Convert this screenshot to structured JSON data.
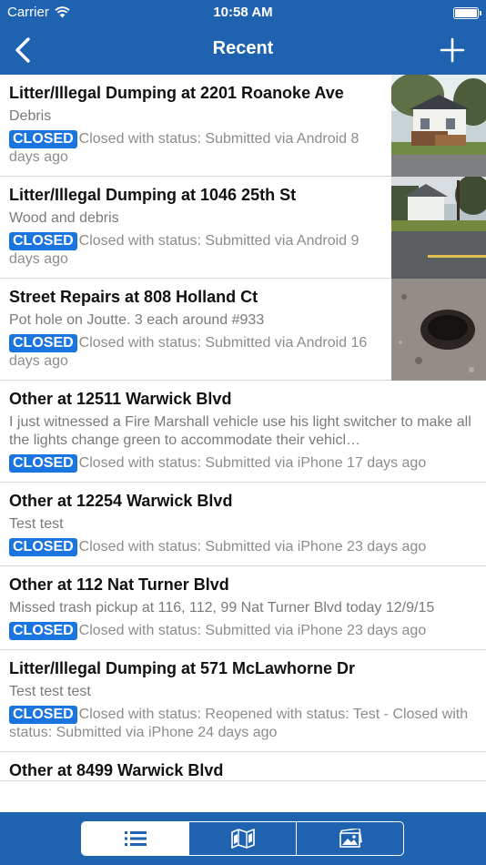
{
  "status_bar": {
    "carrier": "Carrier",
    "time": "10:58 AM"
  },
  "nav": {
    "title": "Recent"
  },
  "badge_label": "CLOSED",
  "reports": [
    {
      "title": "Litter/Illegal Dumping at 2201 Roanoke Ave",
      "description": "Debris",
      "status": "Closed with status: Submitted via Android 8 days ago",
      "thumbnail": "house-with-debris-photo"
    },
    {
      "title": "Litter/Illegal Dumping at 1046 25th St",
      "description": "Wood and debris",
      "status": "Closed with status: Submitted via Android 9 days ago",
      "thumbnail": "street-corner-photo"
    },
    {
      "title": "Street Repairs at 808 Holland Ct",
      "description": "Pot hole on Joutte. 3 each around #933",
      "status": "Closed with status: Submitted via Android 16 days ago",
      "thumbnail": "pothole-photo"
    },
    {
      "title": "Other at 12511 Warwick Blvd",
      "description": "I just witnessed a Fire Marshall vehicle use his light switcher to make all the lights change green to accommodate their vehicl…",
      "status": "Closed with status: Submitted via iPhone 17 days ago"
    },
    {
      "title": "Other at 12254 Warwick Blvd",
      "description": "Test test",
      "status": "Closed with status: Submitted via iPhone 23 days ago"
    },
    {
      "title": "Other at 112 Nat Turner Blvd",
      "description": "Missed trash pickup at 116, 112, 99 Nat Turner Blvd today 12/9/15",
      "status": "Closed with status: Submitted via iPhone 23 days ago"
    },
    {
      "title": "Litter/Illegal Dumping at 571 McLawhorne Dr",
      "description": "Test test test",
      "status": "Closed with status: Reopened with status:  Test - Closed with status: Submitted via iPhone 24 days ago"
    },
    {
      "title": "Other at 8499 Warwick Blvd",
      "description": "",
      "status": ""
    }
  ],
  "tabs": [
    {
      "label": "list-view",
      "icon": "list-icon",
      "selected": true
    },
    {
      "label": "map-view",
      "icon": "map-icon",
      "selected": false
    },
    {
      "label": "photo-view",
      "icon": "photo-gallery-icon",
      "selected": false
    }
  ],
  "colors": {
    "brand_blue": "#1f63b0",
    "badge_blue": "#1a75e0",
    "muted_text": "#8c8c8c"
  }
}
